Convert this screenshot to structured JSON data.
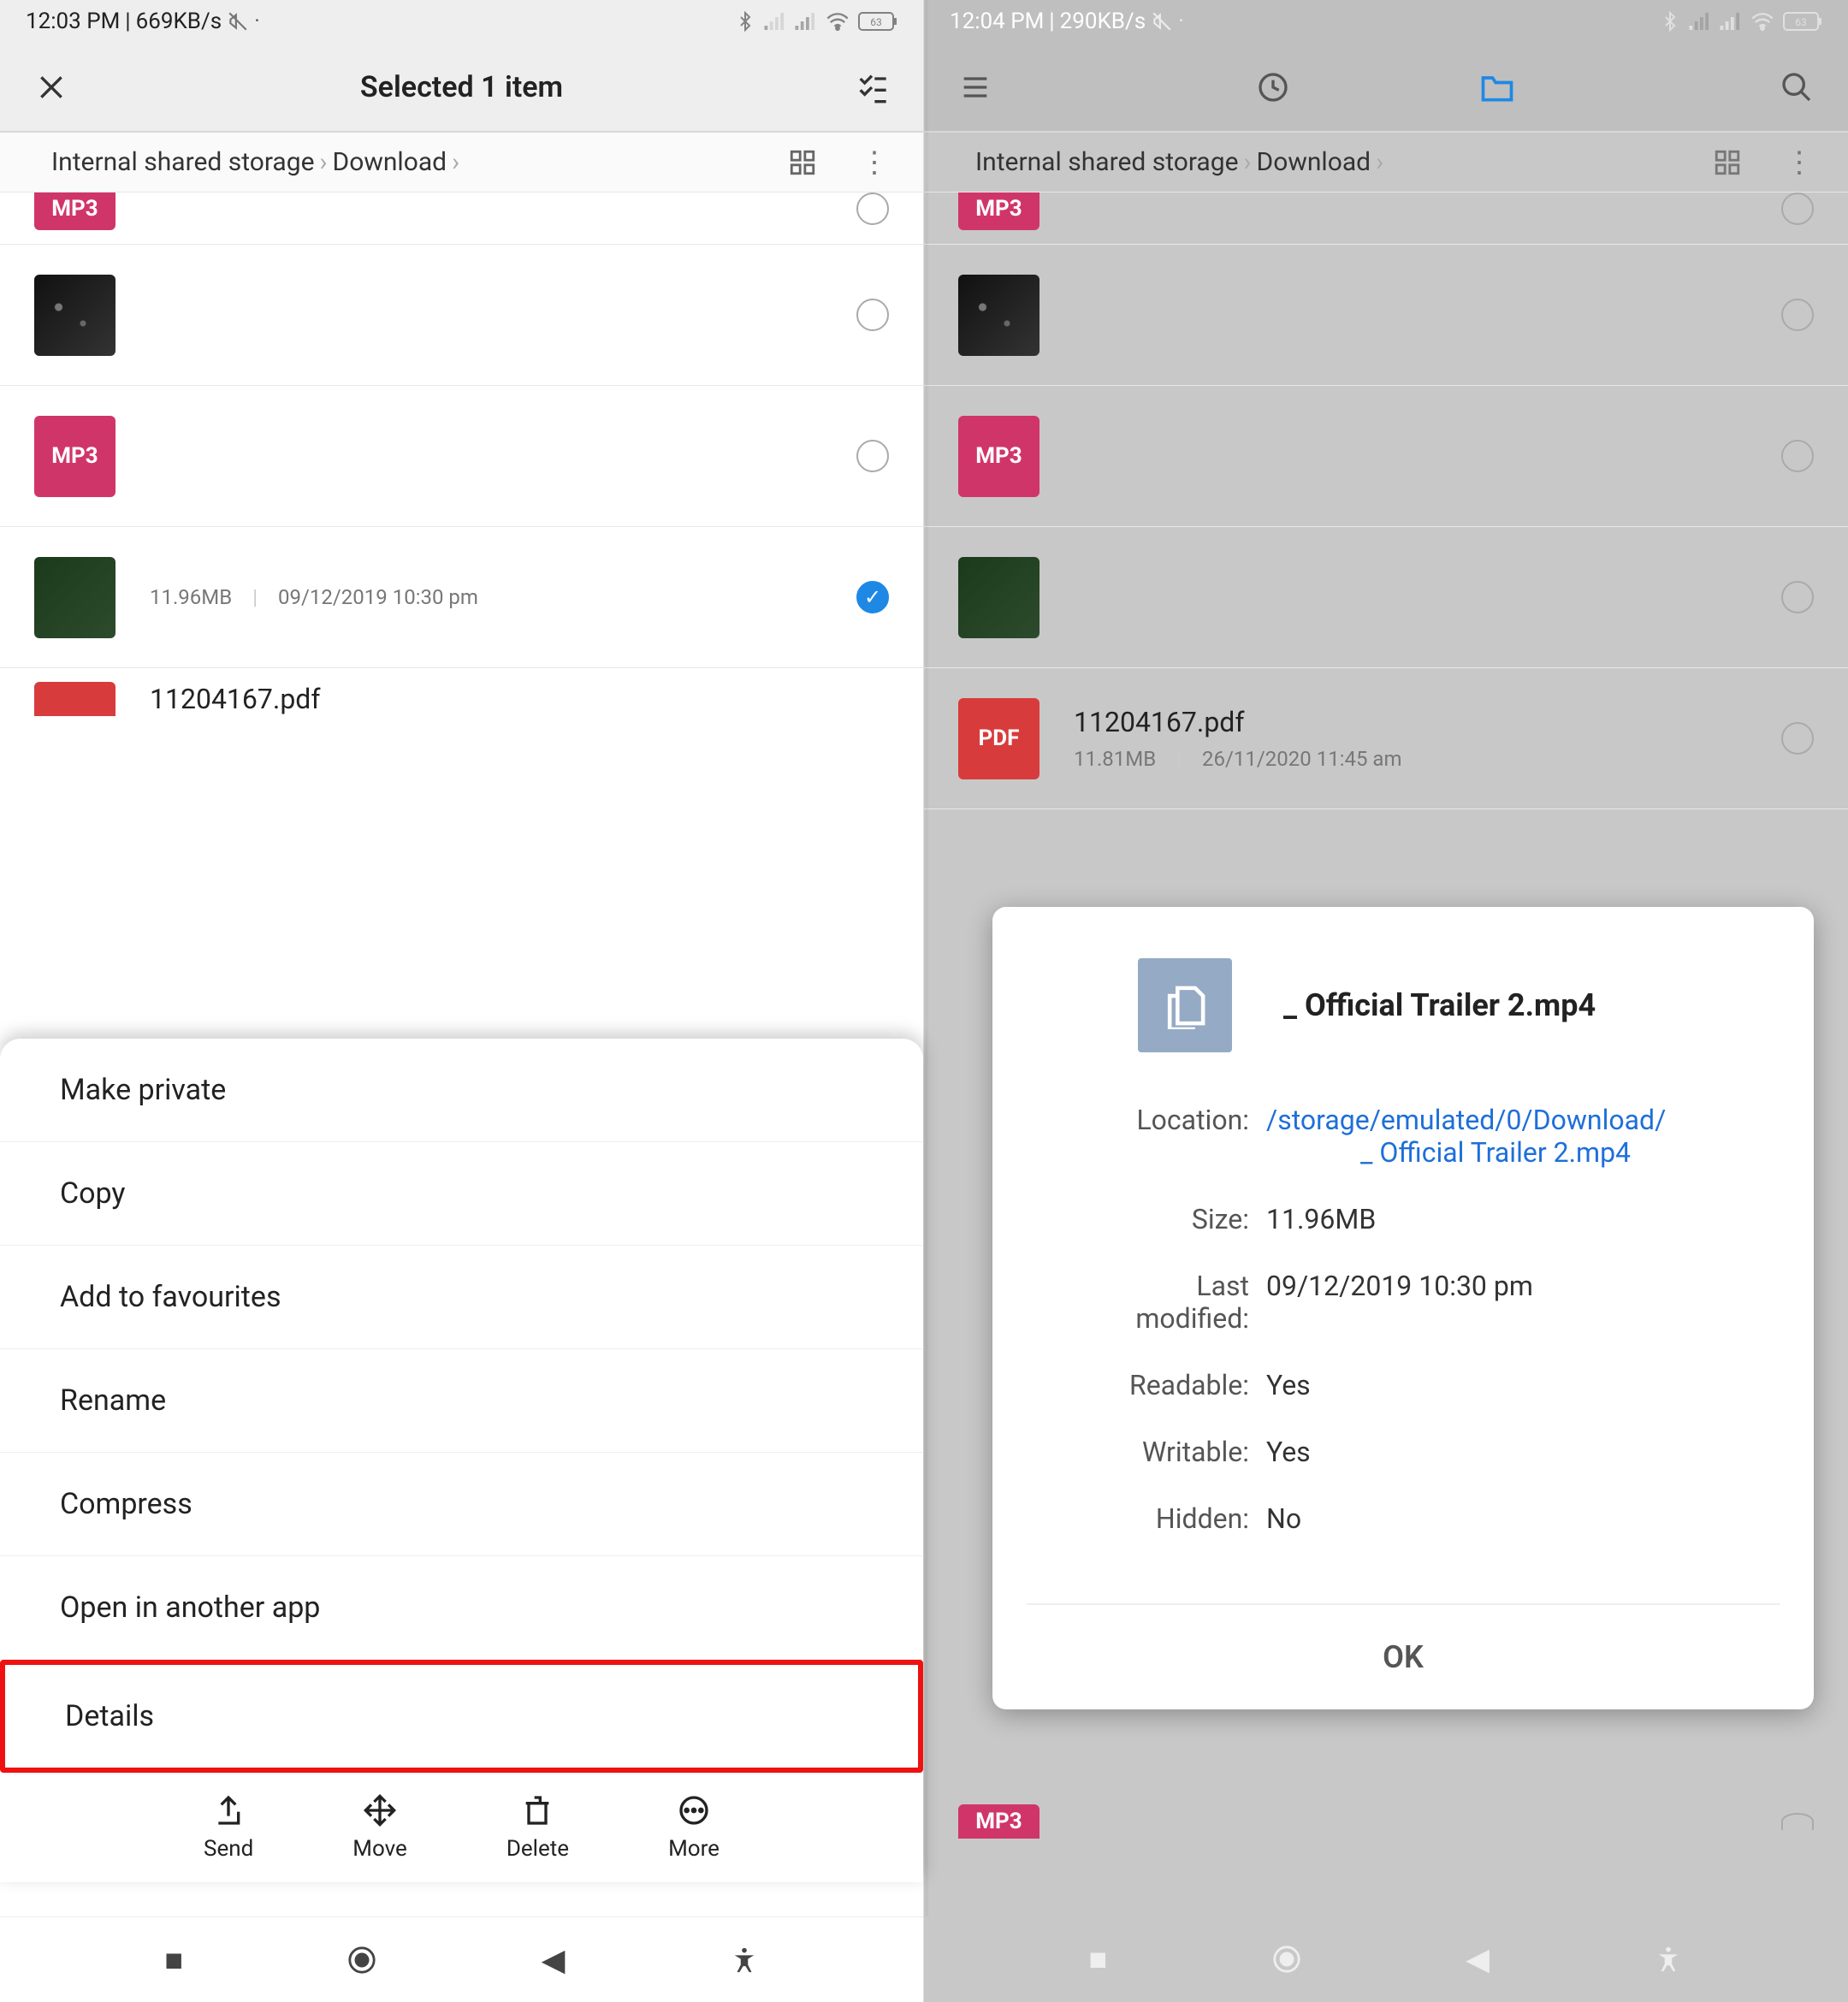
{
  "left": {
    "status": {
      "time": "12:03 PM",
      "speed": "669KB/s",
      "battery": "63"
    },
    "app_bar": {
      "title": "Selected 1 item"
    },
    "breadcrumb": {
      "root": "Internal shared storage",
      "folder": "Download"
    },
    "files": [
      {
        "type": "mp3_partial"
      },
      {
        "type": "img"
      },
      {
        "type": "mp3"
      },
      {
        "type": "vid",
        "size": "11.96MB",
        "date": "09/12/2019 10:30 pm",
        "selected": true
      },
      {
        "type": "pdf_partial",
        "name": "11204167.pdf"
      }
    ],
    "sheet": {
      "options": [
        "Make private",
        "Copy",
        "Add to favourites",
        "Rename",
        "Compress",
        "Open in another app",
        "Details"
      ],
      "highlighted_index": 6,
      "actions": [
        {
          "icon": "share",
          "label": "Send"
        },
        {
          "icon": "move",
          "label": "Move"
        },
        {
          "icon": "trash",
          "label": "Delete"
        },
        {
          "icon": "more",
          "label": "More"
        }
      ]
    }
  },
  "right": {
    "status": {
      "time": "12:04 PM",
      "speed": "290KB/s",
      "battery": "63"
    },
    "breadcrumb": {
      "root": "Internal shared storage",
      "folder": "Download"
    },
    "files": [
      {
        "type": "mp3_partial"
      },
      {
        "type": "img"
      },
      {
        "type": "mp3"
      },
      {
        "type": "vid"
      },
      {
        "type": "pdf",
        "name": "11204167.pdf",
        "size": "11.81MB",
        "date": "26/11/2020 11:45 am"
      },
      {
        "type": "mp3_partial_bottom"
      }
    ],
    "dialog": {
      "title": "_ Official Trailer 2.mp4",
      "location_line1": "/storage/emulated/0/Download/",
      "location_line2": "_ Official Trailer 2.mp4",
      "labels": {
        "location": "Location:",
        "size": "Size:",
        "last_modified_1": "Last",
        "last_modified_2": "modified:",
        "readable": "Readable:",
        "writable": "Writable:",
        "hidden": "Hidden:"
      },
      "size": "11.96MB",
      "last_modified": "09/12/2019 10:30 pm",
      "readable": "Yes",
      "writable": "Yes",
      "hidden": "No",
      "ok": "OK"
    }
  },
  "icons": {
    "mp3": "MP3",
    "pdf": "PDF"
  }
}
